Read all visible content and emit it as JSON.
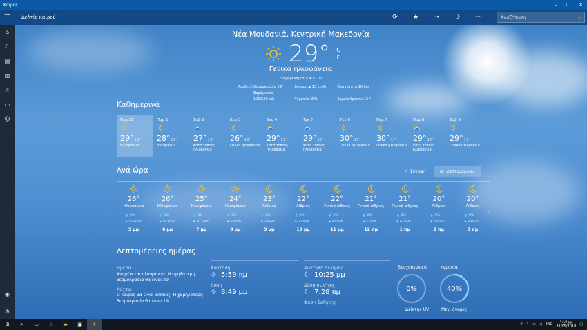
{
  "window": {
    "title": "Καιρός",
    "minimize": "–",
    "maximize": "☐",
    "close": "✕"
  },
  "appbar": {
    "menu_icon": "hamburger-icon",
    "title": "Δελτίο καιρού",
    "search_placeholder": "Αναζήτηση"
  },
  "current": {
    "location": "Νέα Μουδανιά, Κεντρική Μακεδονία",
    "temp": "29°",
    "unit_c": "C",
    "unit_f": "F",
    "condition": "Γενικά ηλιοφάνεια",
    "updated": "Ενημέρωση στις 4:13 μμ",
    "stats": [
      {
        "label": "Αισθητή θερμοκρασία",
        "value": "29°"
      },
      {
        "label": "Άνεμος",
        "value": "▲ 13 km/h"
      },
      {
        "label": "Ορατότητα",
        "value": "10 km"
      },
      {
        "label": "Βαρόμετρο",
        "value": "1014,00 mb"
      },
      {
        "label": "Υγρασία",
        "value": "35%"
      },
      {
        "label": "Σημείο δρόσου",
        "value": "12 °"
      }
    ]
  },
  "daily": {
    "title": "Καθημερινά",
    "days": [
      {
        "day": "Πεμ 31",
        "hi": "29°",
        "lo": "19°",
        "desc": "Ηλιοφάνεια",
        "icon": "sun"
      },
      {
        "day": "Παρ 1",
        "hi": "28°",
        "lo": "21°",
        "desc": "Ηλιοφάνεια",
        "icon": "sun"
      },
      {
        "day": "Σαβ 2",
        "hi": "27°",
        "lo": "19°",
        "desc": "Κατά τόπους ηλιοφάνεια",
        "icon": "partly"
      },
      {
        "day": "Κυρ 3",
        "hi": "26°",
        "lo": "19°",
        "desc": "Γενικά ηλιοφάνεια",
        "icon": "sun"
      },
      {
        "day": "Δευ 4",
        "hi": "29°",
        "lo": "21°",
        "desc": "Κατά τόπους ηλιοφάνεια",
        "icon": "partly"
      },
      {
        "day": "Τρι 5",
        "hi": "29°",
        "lo": "17°",
        "desc": "Κατά τόπους ηλιοφάνεια",
        "icon": "partly"
      },
      {
        "day": "Τετ 6",
        "hi": "30°",
        "lo": "17°",
        "desc": "Γενικά ηλιοφάνεια",
        "icon": "sun"
      },
      {
        "day": "Πεμ 7",
        "hi": "30°",
        "lo": "17°",
        "desc": "Γενικά ηλιοφάνεια",
        "icon": "sun"
      },
      {
        "day": "Παρ 8",
        "hi": "29°",
        "lo": "17°",
        "desc": "Κατά τόπους ηλιοφάνεια",
        "icon": "partly"
      },
      {
        "day": "Σαβ 9",
        "hi": "29°",
        "lo": "17°",
        "desc": "Γενικά ηλιοφάνεια",
        "icon": "sun"
      }
    ]
  },
  "hourly": {
    "title": "Ανά ώρα",
    "summary_btn": "Σύνοψη",
    "details_btn": "Λεπτομέρειες",
    "hours": [
      {
        "time": "5 μμ",
        "temp": "26°",
        "desc": "Ηλιοφάνεια",
        "precip": "0%",
        "wind": "11 km/h",
        "icon": "sun"
      },
      {
        "time": "6 μμ",
        "temp": "26°",
        "desc": "Ηλιοφάνεια",
        "precip": "0%",
        "wind": "14 km/h",
        "icon": "sun"
      },
      {
        "time": "7 μμ",
        "temp": "25°",
        "desc": "Ηλιοφάνεια",
        "precip": "0%",
        "wind": "10 km/h",
        "icon": "sun"
      },
      {
        "time": "8 μμ",
        "temp": "24°",
        "desc": "Ηλιοφάνεια",
        "precip": "0%",
        "wind": "6 km/h",
        "icon": "sun"
      },
      {
        "time": "9 μμ",
        "temp": "23°",
        "desc": "Αίθριος",
        "precip": "0%",
        "wind": "3 km/h",
        "icon": "moon"
      },
      {
        "time": "10 μμ",
        "temp": "22°",
        "desc": "Αίθριος",
        "precip": "0%",
        "wind": "3 km/h",
        "icon": "moon"
      },
      {
        "time": "11 μμ",
        "temp": "22°",
        "desc": "Γενικά αίθριος",
        "precip": "0%",
        "wind": "4 km/h",
        "icon": "moon"
      },
      {
        "time": "12 πμ",
        "temp": "21°",
        "desc": "Γενικά αίθριος",
        "precip": "0%",
        "wind": "5 km/h",
        "icon": "moon"
      },
      {
        "time": "1 πμ",
        "temp": "21°",
        "desc": "Γενικά αίθριος",
        "precip": "0%",
        "wind": "6 km/h",
        "icon": "moon"
      },
      {
        "time": "2 πμ",
        "temp": "20°",
        "desc": "Αίθριος",
        "precip": "0%",
        "wind": "7 km/h",
        "icon": "moon"
      },
      {
        "time": "3 πμ",
        "temp": "20°",
        "desc": "Αίθριος",
        "precip": "0%",
        "wind": "8 km/h",
        "icon": "moon"
      }
    ]
  },
  "details": {
    "title": "Λεπτομέρειες ημέρας",
    "day_label": "Ημέρα",
    "day_text": "Αναμένεται ηλιοφάνεια. Η υψηλότερη θερμοκρασία θα είναι 29.",
    "night_label": "Νύχτα",
    "night_text": "Ο καιρός θα είναι αίθριος. Η χαμηλότερη θερμοκρασία θα είναι 19.",
    "sunrise_label": "Ανατολή",
    "sunrise": "5:59 πμ",
    "sunset_label": "Δύση",
    "sunset": "8:49 μμ",
    "moonrise_label": "Ανατολή σελήνης",
    "moonrise": "10:25 μμ",
    "moonset_label": "Δύση σελήνης",
    "moonset": "7:28 πμ",
    "moonphase_label": "Φάση Σελήνης",
    "precip_label": "Βροχοπτώσεις",
    "precip": "0%",
    "uv_label": "Δείκτης UV",
    "humidity_label": "Υγρασία",
    "humidity": "40%",
    "humidity_fraction": 0.4,
    "wind_label": "Μεγ. άνεμος"
  },
  "taskbar": {
    "lang": "ENG",
    "time": "4:16 μμ",
    "date": "31/05/2018"
  }
}
